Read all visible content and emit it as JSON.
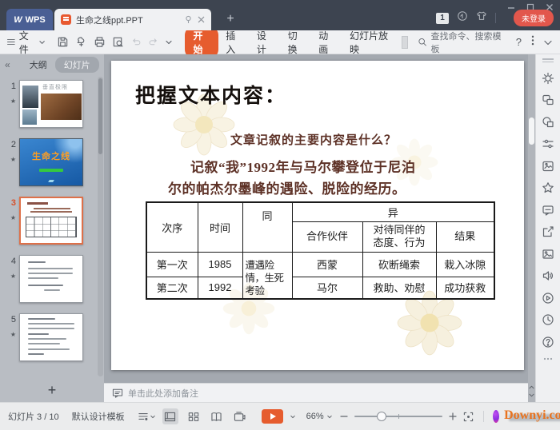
{
  "titlebar": {
    "logo_w": "W",
    "logo_text": "WPS",
    "doc_title": "生命之线ppt.PPT",
    "new_tab": "+",
    "badge": "1",
    "login": "未登录"
  },
  "menu": {
    "file": "文件"
  },
  "ribbon": {
    "tabs": [
      "开始",
      "插入",
      "设计",
      "切换",
      "动画",
      "幻灯片放映"
    ],
    "active_tab": "开始",
    "search": "查找命令、搜索模板",
    "help": "?"
  },
  "sidebar": {
    "collapse": "«",
    "outline_tab": "大纲",
    "slides_tab": "幻灯片",
    "star": "★",
    "add": "+",
    "slides": [
      {
        "num": "1",
        "title": "垂直极限"
      },
      {
        "num": "2",
        "title": "生命之线"
      },
      {
        "num": "3"
      },
      {
        "num": "4"
      },
      {
        "num": "5"
      }
    ]
  },
  "slide": {
    "title": "把握文本内容：",
    "question": "文章记叙的主要内容是什么？",
    "body1": "记叙“我”1992年与马尔攀登位于尼泊",
    "body2": "尔的帕杰尔墨峰的遇险、脱险的经历。",
    "table": {
      "h_order": "次序",
      "h_time": "时间",
      "h_same": "同",
      "h_diff": "异",
      "h_partner": "合作伙伴",
      "h_attitude": "对待同伴的态度、行为",
      "h_result": "结果",
      "same_cell": "遭遇险情，生死考验",
      "rows": [
        {
          "order": "第一次",
          "time": "1985",
          "partner": "西蒙",
          "attitude": "砍断绳索",
          "result": "栽入冰隙"
        },
        {
          "order": "第二次",
          "time": "1992",
          "partner": "马尔",
          "attitude": "救助、劝慰",
          "result": "成功获救"
        }
      ]
    }
  },
  "notes": {
    "placeholder": "单击此处添加备注"
  },
  "statusbar": {
    "counter": "幻灯片 3 / 10",
    "template": "默认设计模板",
    "zoom": "66%"
  },
  "watermark": "Downyi.com",
  "colors": {
    "accent_orange": "#e65c2e",
    "titlebar_dark": "#3d4450",
    "wps_blue": "#4a5f94",
    "slide_text_maroon": "#5d3126",
    "selection_orange": "#de7049",
    "watermark_orange": "#e8731f",
    "thumb2_bg_blue": "#2f7ac2",
    "thumb2_title_orange": "#ff9f21",
    "login_red": "#e2574c"
  }
}
